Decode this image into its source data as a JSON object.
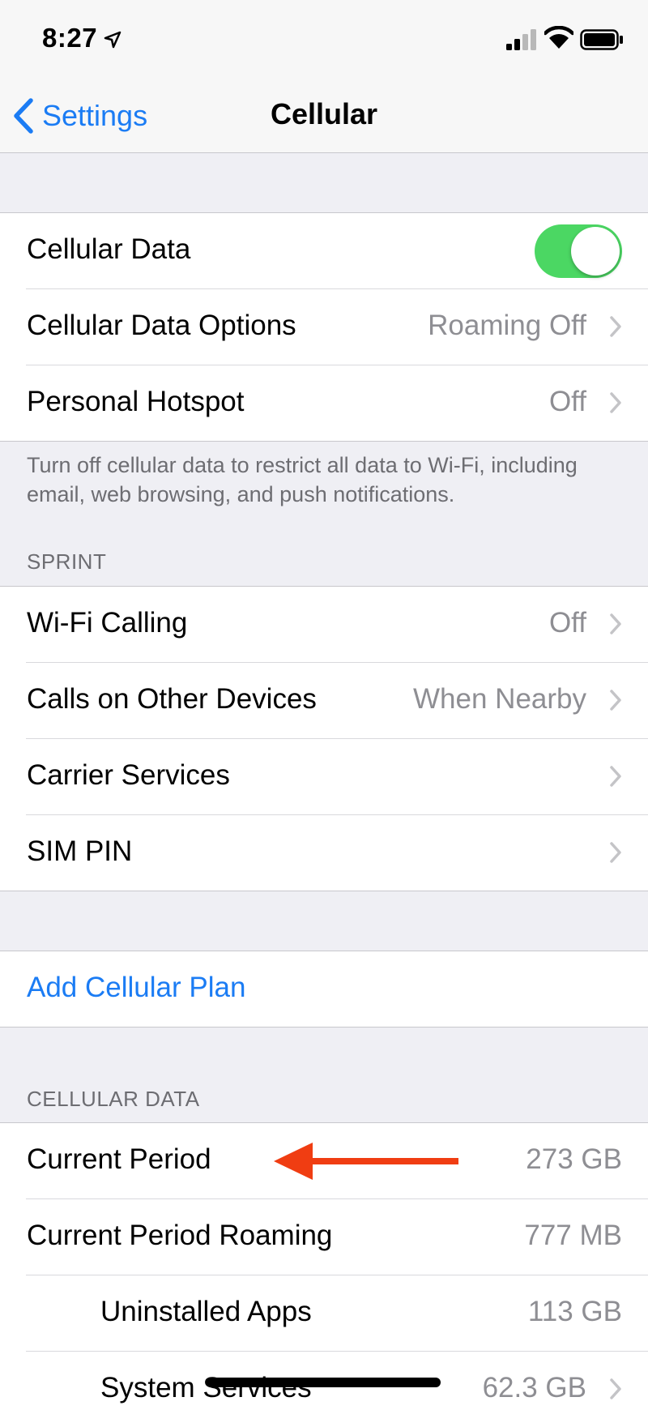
{
  "status": {
    "time": "8:27"
  },
  "nav": {
    "back_label": "Settings",
    "title": "Cellular"
  },
  "group1": {
    "cellular_data": {
      "label": "Cellular Data",
      "on": true
    },
    "cellular_data_options": {
      "label": "Cellular Data Options",
      "value": "Roaming Off"
    },
    "personal_hotspot": {
      "label": "Personal Hotspot",
      "value": "Off"
    }
  },
  "group1_footer": "Turn off cellular data to restrict all data to Wi-Fi, including email, web browsing, and push notifications.",
  "sprint": {
    "header": "SPRINT",
    "wifi_calling": {
      "label": "Wi-Fi Calling",
      "value": "Off"
    },
    "calls_other_devices": {
      "label": "Calls on Other Devices",
      "value": "When Nearby"
    },
    "carrier_services": {
      "label": "Carrier Services"
    },
    "sim_pin": {
      "label": "SIM PIN"
    }
  },
  "plan": {
    "add_label": "Add Cellular Plan"
  },
  "usage": {
    "header": "CELLULAR DATA",
    "current_period": {
      "label": "Current Period",
      "value": "273 GB"
    },
    "current_period_roaming": {
      "label": "Current Period Roaming",
      "value": "777 MB"
    },
    "uninstalled_apps": {
      "label": "Uninstalled Apps",
      "value": "113 GB"
    },
    "system_services": {
      "label": "System Services",
      "value": "62.3 GB"
    }
  },
  "colors": {
    "accent": "#1b7cf4",
    "toggle_on": "#4bd763",
    "annotation_arrow": "#f03d12"
  }
}
